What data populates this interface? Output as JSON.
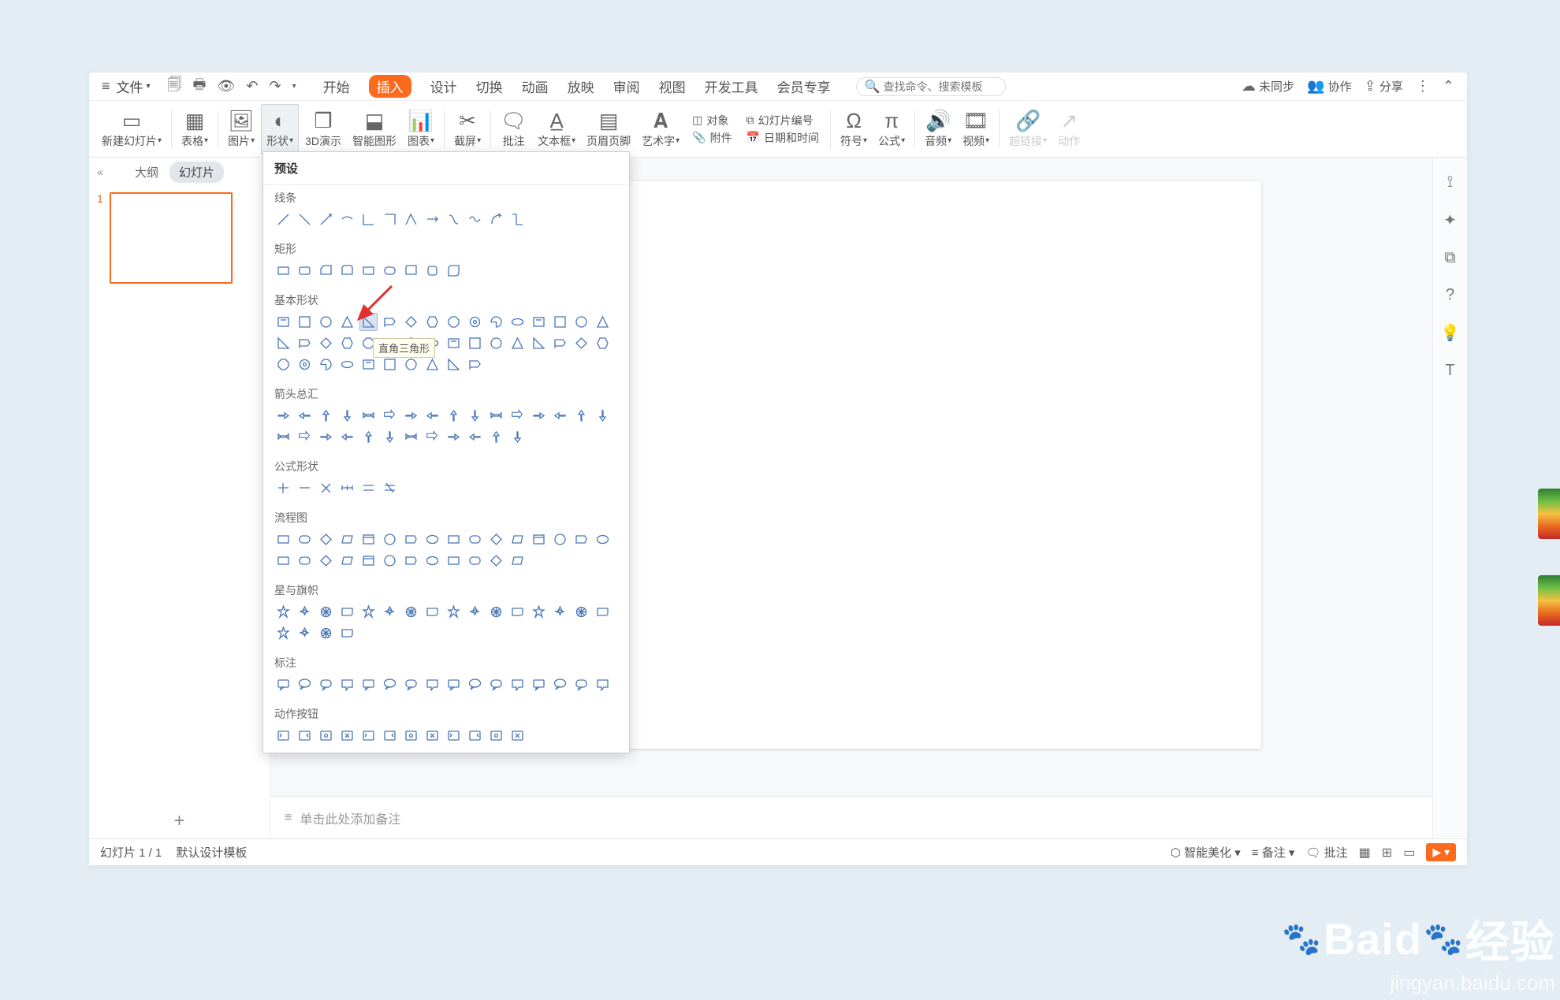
{
  "menu": {
    "file_label": "文件",
    "tabs": [
      "开始",
      "插入",
      "设计",
      "切换",
      "动画",
      "放映",
      "审阅",
      "视图",
      "开发工具",
      "会员专享"
    ],
    "active_tab": 1,
    "search_placeholder": "查找命令、搜索模板",
    "right": {
      "sync": "未同步",
      "collab": "协作",
      "share": "分享"
    }
  },
  "ribbon": {
    "items": [
      {
        "label": "新建幻灯片",
        "dd": true
      },
      {
        "label": "表格",
        "dd": true
      },
      {
        "label": "图片",
        "dd": true
      },
      {
        "label": "形状",
        "dd": true,
        "on": true
      },
      {
        "label": "3D演示"
      },
      {
        "label": "智能图形"
      },
      {
        "label": "图表",
        "dd": true
      },
      {
        "label": "截屏",
        "dd": true
      },
      {
        "label": "批注"
      },
      {
        "label": "文本框",
        "dd": true
      },
      {
        "label": "页眉页脚"
      },
      {
        "label": "艺术字",
        "dd": true
      }
    ],
    "thin1": [
      "对象",
      "幻灯片编号",
      "附件",
      "日期和时间"
    ],
    "items2": [
      {
        "label": "符号",
        "dd": true
      },
      {
        "label": "公式",
        "dd": true
      },
      {
        "label": "音频",
        "dd": true
      },
      {
        "label": "视频",
        "dd": true
      },
      {
        "label": "超链接",
        "dd": true,
        "dim": true
      },
      {
        "label": "动作",
        "dim": true
      }
    ]
  },
  "side": {
    "tab_outline": "大纲",
    "tab_slides": "幻灯片",
    "collapse": "«",
    "thumb_num": "1",
    "add": "+"
  },
  "notes_placeholder": "单击此处添加备注",
  "status": {
    "left": [
      "幻灯片 1 / 1",
      "默认设计模板"
    ],
    "right": {
      "smart": "智能美化",
      "notes": "备注",
      "comments": "批注"
    }
  },
  "panel": {
    "title": "预设",
    "tooltip": "直角三角形",
    "cats": [
      {
        "name": "线条",
        "count": 12
      },
      {
        "name": "矩形",
        "count": 9
      },
      {
        "name": "基本形状",
        "count": 42,
        "sel": 4
      },
      {
        "name": "箭头总汇",
        "count": 28
      },
      {
        "name": "公式形状",
        "count": 6
      },
      {
        "name": "流程图",
        "count": 28
      },
      {
        "name": "星与旗帜",
        "count": 20
      },
      {
        "name": "标注",
        "count": 16
      },
      {
        "name": "动作按钮",
        "count": 12
      }
    ]
  },
  "watermark": {
    "brand": "Baid",
    "brand2": "经验",
    "url": "jingyan.baidu.com"
  }
}
